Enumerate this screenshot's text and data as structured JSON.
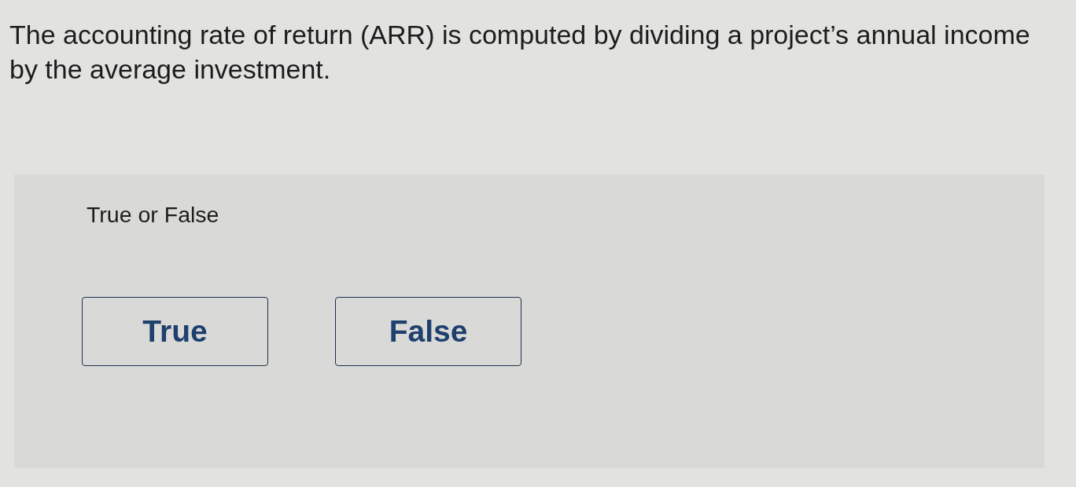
{
  "question": {
    "text": "The accounting rate of return (ARR) is computed by dividing a project’s annual income by the average investment."
  },
  "answer_panel": {
    "prompt": "True or False",
    "options": [
      {
        "label": "True",
        "selected": false
      },
      {
        "label": "False",
        "selected": false
      }
    ]
  }
}
